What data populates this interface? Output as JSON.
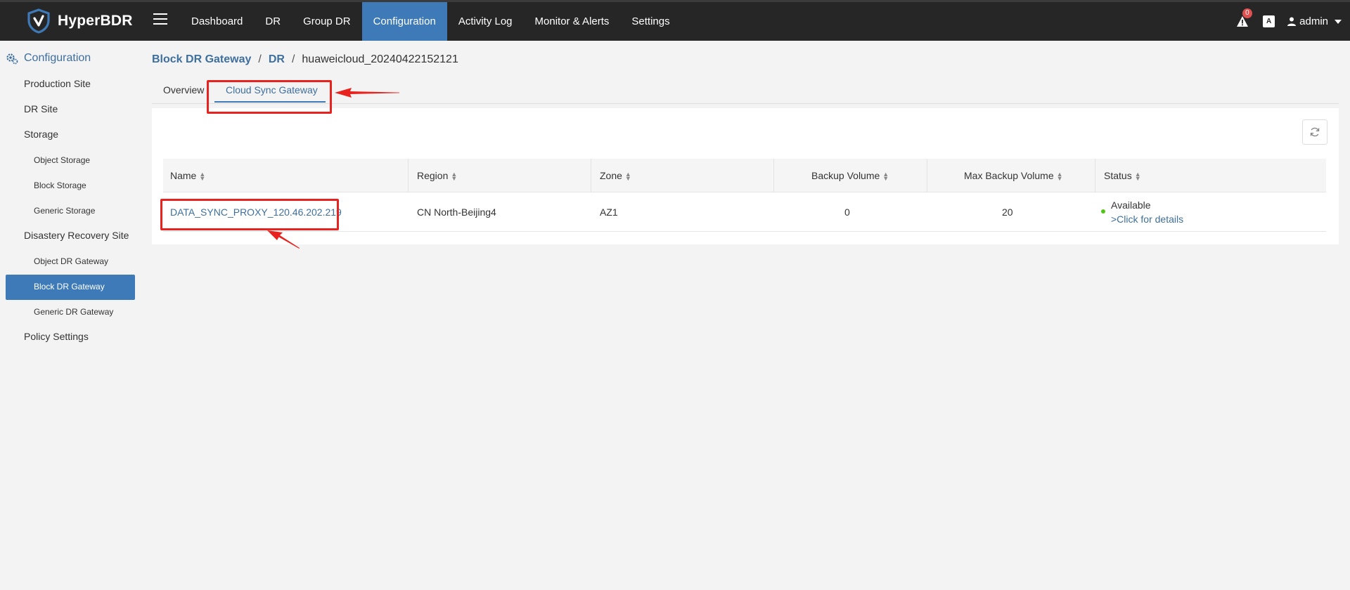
{
  "app": {
    "brand": "HyperBDR"
  },
  "nav": {
    "items": [
      {
        "label": "Dashboard",
        "active": false
      },
      {
        "label": "DR",
        "active": false
      },
      {
        "label": "Group DR",
        "active": false
      },
      {
        "label": "Configuration",
        "active": true
      },
      {
        "label": "Activity Log",
        "active": false
      },
      {
        "label": "Monitor & Alerts",
        "active": false
      },
      {
        "label": "Settings",
        "active": false
      }
    ],
    "alerts_count": "0",
    "lang_icon": "A",
    "user": "admin"
  },
  "sidebar": {
    "title": "Configuration",
    "items": {
      "production_site": "Production Site",
      "dr_site": "DR Site",
      "storage": "Storage",
      "object_storage": "Object Storage",
      "block_storage": "Block Storage",
      "generic_storage": "Generic Storage",
      "disaster_recovery_site": "Disastery Recovery Site",
      "object_dr_gateway": "Object DR Gateway",
      "block_dr_gateway": "Block DR Gateway",
      "generic_dr_gateway": "Generic DR Gateway",
      "policy_settings": "Policy Settings"
    },
    "active": "Block DR Gateway"
  },
  "breadcrumb": {
    "level1": "Block DR Gateway",
    "level2": "DR",
    "current": "huaweicloud_20240422152121",
    "separator": "/"
  },
  "tabs": {
    "overview": "Overview",
    "cloud_sync_gateway": "Cloud Sync Gateway",
    "active": "Cloud Sync Gateway"
  },
  "table": {
    "columns": {
      "name": "Name",
      "region": "Region",
      "zone": "Zone",
      "backup_volume": "Backup Volume",
      "max_backup_volume": "Max Backup Volume",
      "status": "Status"
    },
    "rows": [
      {
        "name": "DATA_SYNC_PROXY_120.46.202.219",
        "region": "CN North-Beijing4",
        "zone": "AZ1",
        "backup_volume": "0",
        "max_backup_volume": "20",
        "status": "Available",
        "status_link": ">Click for details"
      }
    ]
  },
  "colors": {
    "topbar": "#262626",
    "accent": "#3e7ab8",
    "link": "#3e6f9e",
    "annotation": "#e8231f",
    "status_ok": "#52c41a"
  }
}
